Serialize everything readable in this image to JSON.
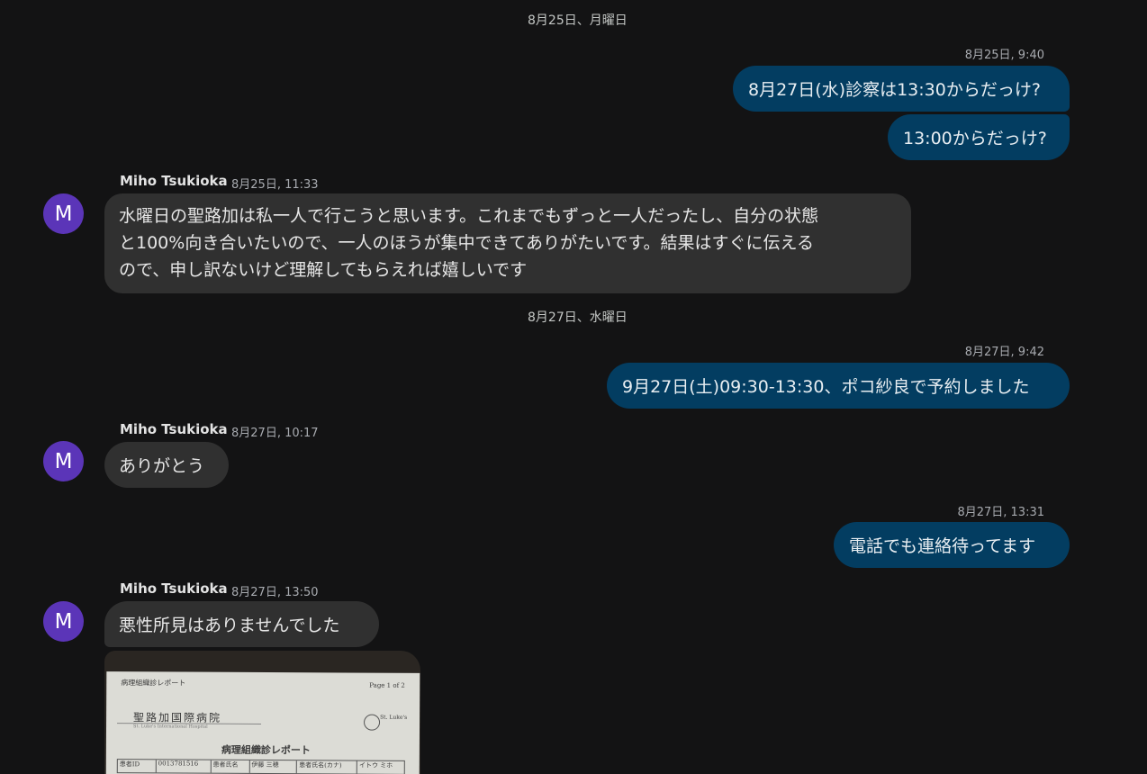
{
  "date_separators": [
    "8月25日、月曜日",
    "8月27日、水曜日"
  ],
  "avatar_initial": "M",
  "messages": [
    {
      "time": "8月25日, 9:40",
      "bubbles": [
        "8月27日(水)診察は13:30からだっけ?",
        "13:00からだっけ?"
      ]
    },
    {
      "sender": "Miho Tsukioka",
      "time": "8月25日, 11:33",
      "lines": [
        "水曜日の聖路加は私一人で行こうと思います。これまでもずっと一人だったし、自分の状態",
        "と100%向き合いたいので、一人のほうが集中できてありがたいです。結果はすぐに伝える",
        "ので、申し訳ないけど理解してもらえれば嬉しいです"
      ]
    },
    {
      "time": "8月27日, 9:42",
      "bubbles": [
        "9月27日(土)09:30-13:30、ポコ紗良で予約しました"
      ]
    },
    {
      "sender": "Miho Tsukioka",
      "time": "8月27日, 10:17",
      "text": "ありがとう"
    },
    {
      "time": "8月27日, 13:31",
      "bubbles": [
        "電話でも連絡待ってます"
      ]
    },
    {
      "sender": "Miho Tsukioka",
      "time": "8月27日, 13:50",
      "text": "悪性所見はありませんでした"
    }
  ],
  "attachment_photo": {
    "doc_header": "病理組織診レポート",
    "page": "Page 1 of 2",
    "hospital": "聖路加国際病院",
    "hospital_en": "St. Luke's International Hospital",
    "logo_text": "St. Luke's",
    "doc_title": "病理組織診レポート",
    "table": [
      "患者ID",
      "0013781516",
      "患者氏名",
      "伊藤 三穂",
      "患者氏名(カナ)",
      "イトウ ミホ"
    ]
  },
  "colors": {
    "outgoing_bubble": "#033d61",
    "incoming_bubble": "#303030",
    "avatar": "#5b35b8",
    "background": "#131314"
  }
}
